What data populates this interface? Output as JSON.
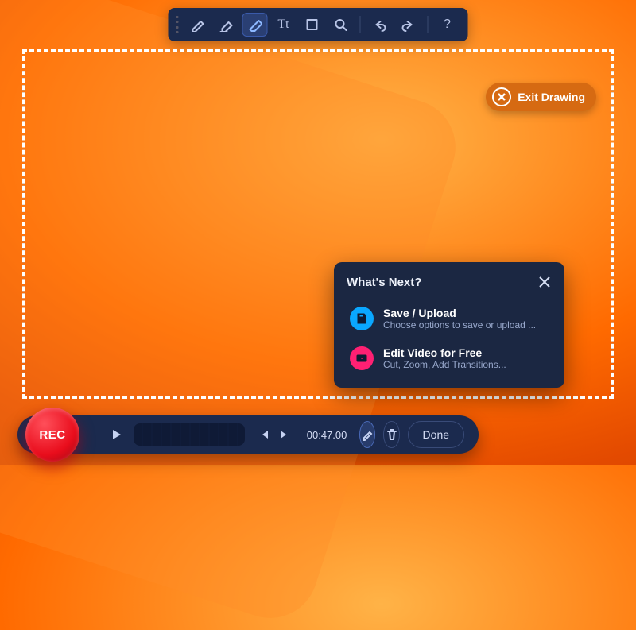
{
  "toolbar": {
    "tools": [
      "pen",
      "highlighter",
      "eraser",
      "text",
      "rectangle",
      "magnifier",
      "undo",
      "redo",
      "help"
    ],
    "active_index": 2,
    "text_label": "Tt",
    "help_label": "?"
  },
  "exit_drawing": {
    "label": "Exit Drawing"
  },
  "popup": {
    "title": "What's Next?",
    "items": [
      {
        "title": "Save / Upload",
        "subtitle": "Choose options to save or upload ..."
      },
      {
        "title": "Edit Video for Free",
        "subtitle": "Cut, Zoom, Add Transitions..."
      }
    ]
  },
  "controls": {
    "rec_label": "REC",
    "time": "00:47.00",
    "done_label": "Done"
  }
}
